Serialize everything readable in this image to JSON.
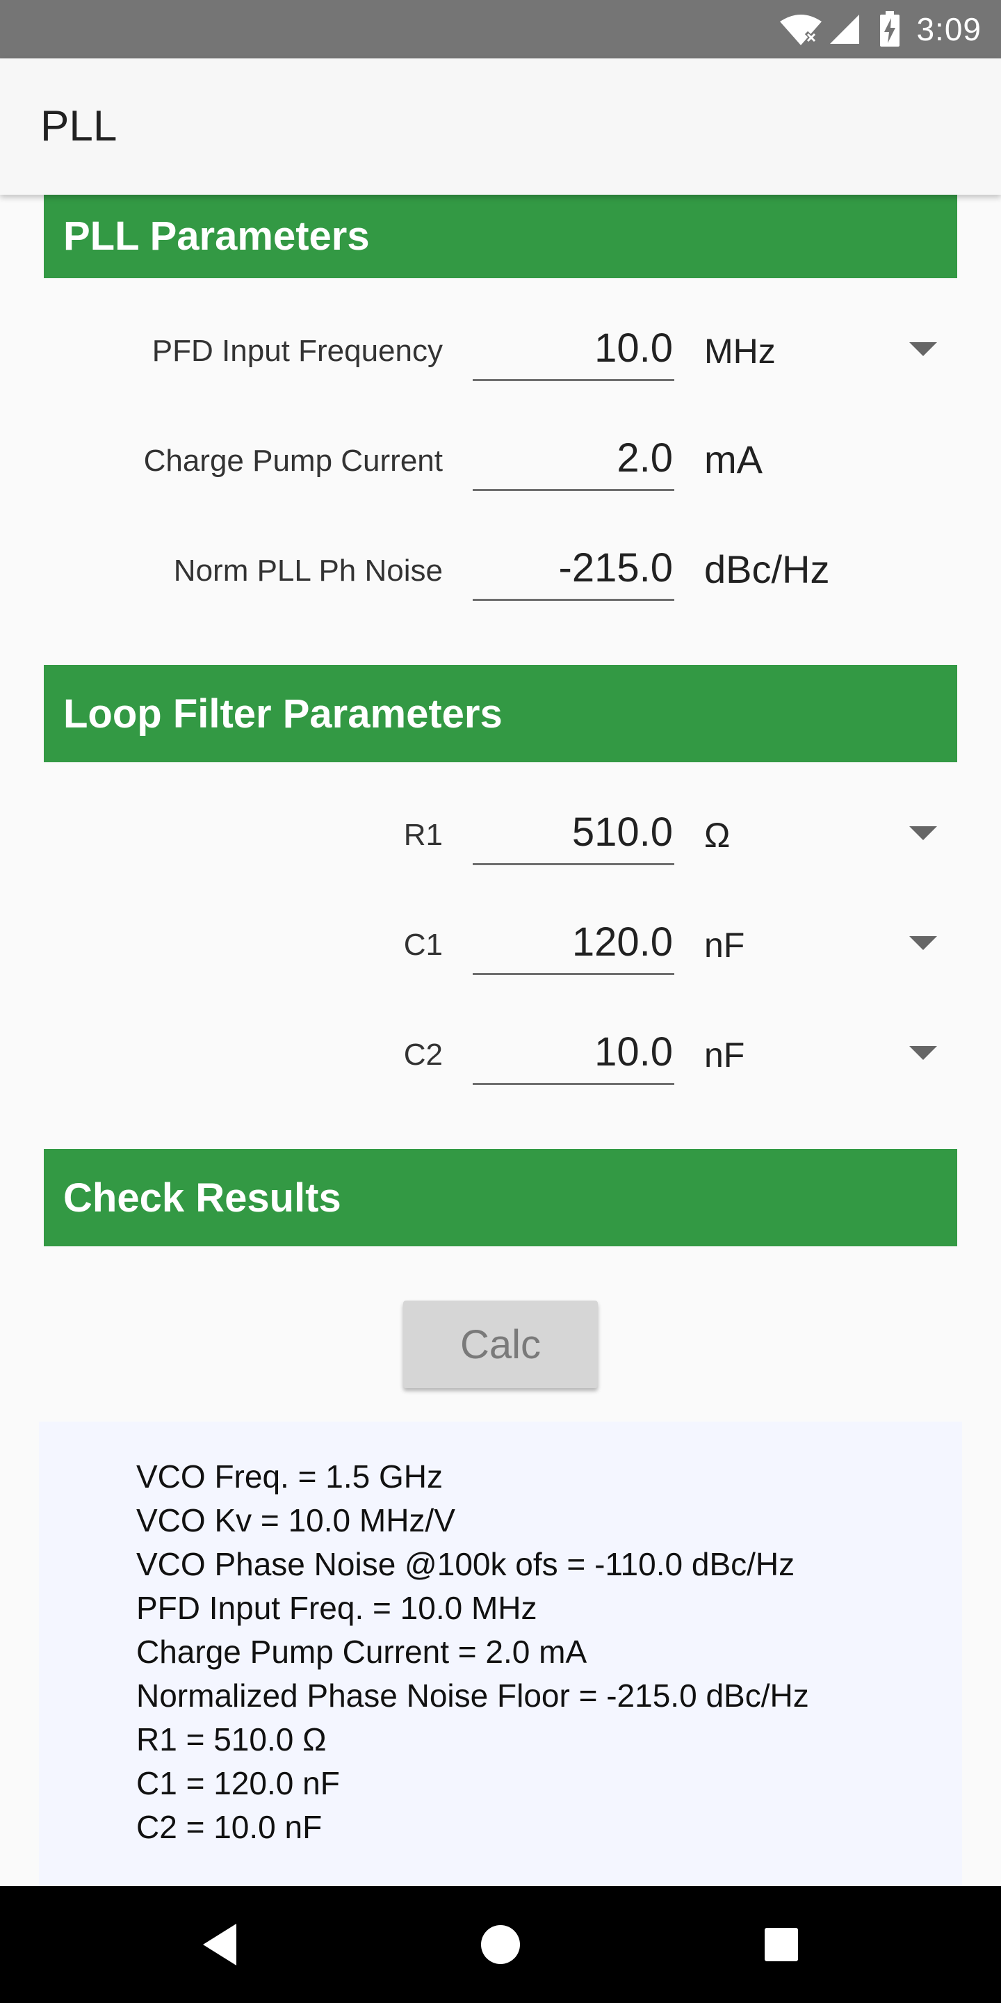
{
  "status_bar": {
    "time": "3:09"
  },
  "app_bar": {
    "title": "PLL"
  },
  "sections": {
    "pll_parameters": "PLL Parameters",
    "loop_filter_parameters": "Loop Filter Parameters",
    "check_results": "Check Results"
  },
  "pll": {
    "pfd_input_frequency": {
      "label": "PFD Input Frequency",
      "value": "10.0",
      "unit": "MHz"
    },
    "charge_pump_current": {
      "label": "Charge Pump Current",
      "value": "2.0",
      "unit": "mA"
    },
    "norm_pll_ph_noise": {
      "label": "Norm PLL Ph Noise",
      "value": "-215.0",
      "unit": "dBc/Hz"
    }
  },
  "loop_filter": {
    "r1": {
      "label": "R1",
      "value": "510.0",
      "unit": "Ω"
    },
    "c1": {
      "label": "C1",
      "value": "120.0",
      "unit": "nF"
    },
    "c2": {
      "label": "C2",
      "value": "10.0",
      "unit": "nF"
    }
  },
  "calc_button": {
    "label": "Calc"
  },
  "results": [
    "VCO Freq. = 1.5 GHz",
    "VCO Kv = 10.0 MHz/V",
    "VCO Phase Noise @100k ofs = -110.0 dBc/Hz",
    "PFD Input Freq. = 10.0 MHz",
    "Charge Pump Current = 2.0 mA",
    "Normalized Phase Noise Floor = -215.0 dBc/Hz",
    "R1 = 510.0 Ω",
    "C1 = 120.0 nF",
    "C2 = 10.0 nF"
  ],
  "colors": {
    "status_bar": "#757575",
    "section_header": "#339944",
    "results_background": "#F4F6FF",
    "nav_bar": "#000000"
  },
  "icons": {
    "status": [
      "wifi-icon",
      "signal-icon",
      "battery-charging-icon"
    ],
    "dropdown": "triangle-down-icon",
    "nav": [
      "back-icon",
      "home-icon",
      "recents-icon"
    ]
  }
}
